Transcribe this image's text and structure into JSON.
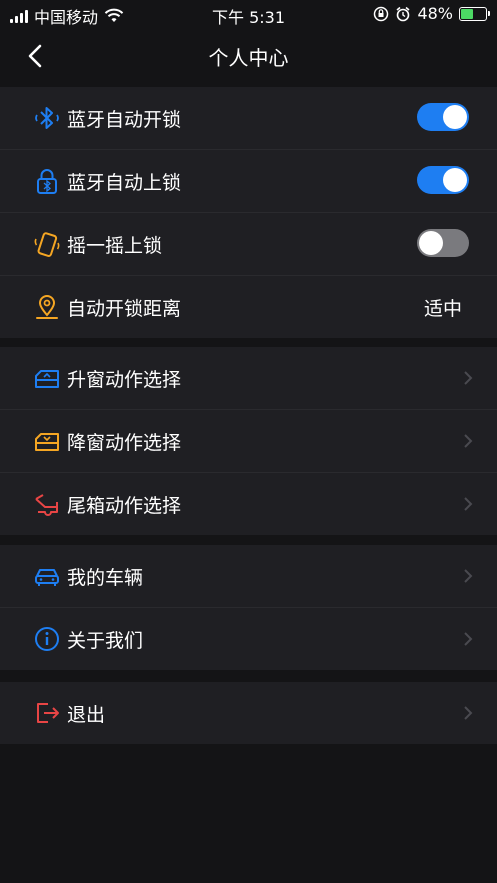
{
  "status": {
    "carrier": "中国移动",
    "time": "下午 5:31",
    "battery_pct": "48%"
  },
  "nav": {
    "title": "个人中心"
  },
  "groups": [
    {
      "rows": [
        {
          "label": "蓝牙自动开锁",
          "icon": "bluetooth-icon",
          "toggle_on": true
        },
        {
          "label": "蓝牙自动上锁",
          "icon": "lock-bluetooth-icon",
          "toggle_on": true
        },
        {
          "label": "摇一摇上锁",
          "icon": "shake-phone-icon",
          "toggle_on": false
        },
        {
          "label": "自动开锁距离",
          "icon": "location-pin-icon",
          "value": "适中"
        }
      ]
    },
    {
      "rows": [
        {
          "label": "升窗动作选择",
          "icon": "window-up-icon"
        },
        {
          "label": "降窗动作选择",
          "icon": "window-down-icon"
        },
        {
          "label": "尾箱动作选择",
          "icon": "trunk-icon"
        }
      ]
    },
    {
      "rows": [
        {
          "label": "我的车辆",
          "icon": "car-icon"
        },
        {
          "label": "关于我们",
          "icon": "info-icon"
        }
      ]
    },
    {
      "rows": [
        {
          "label": "退出",
          "icon": "logout-icon"
        }
      ]
    }
  ],
  "colors": {
    "accent_blue": "#1e7ef2",
    "icon_orange": "#f5a623",
    "icon_red": "#e84545",
    "background": "#141416",
    "row_background": "#1f1f23"
  }
}
